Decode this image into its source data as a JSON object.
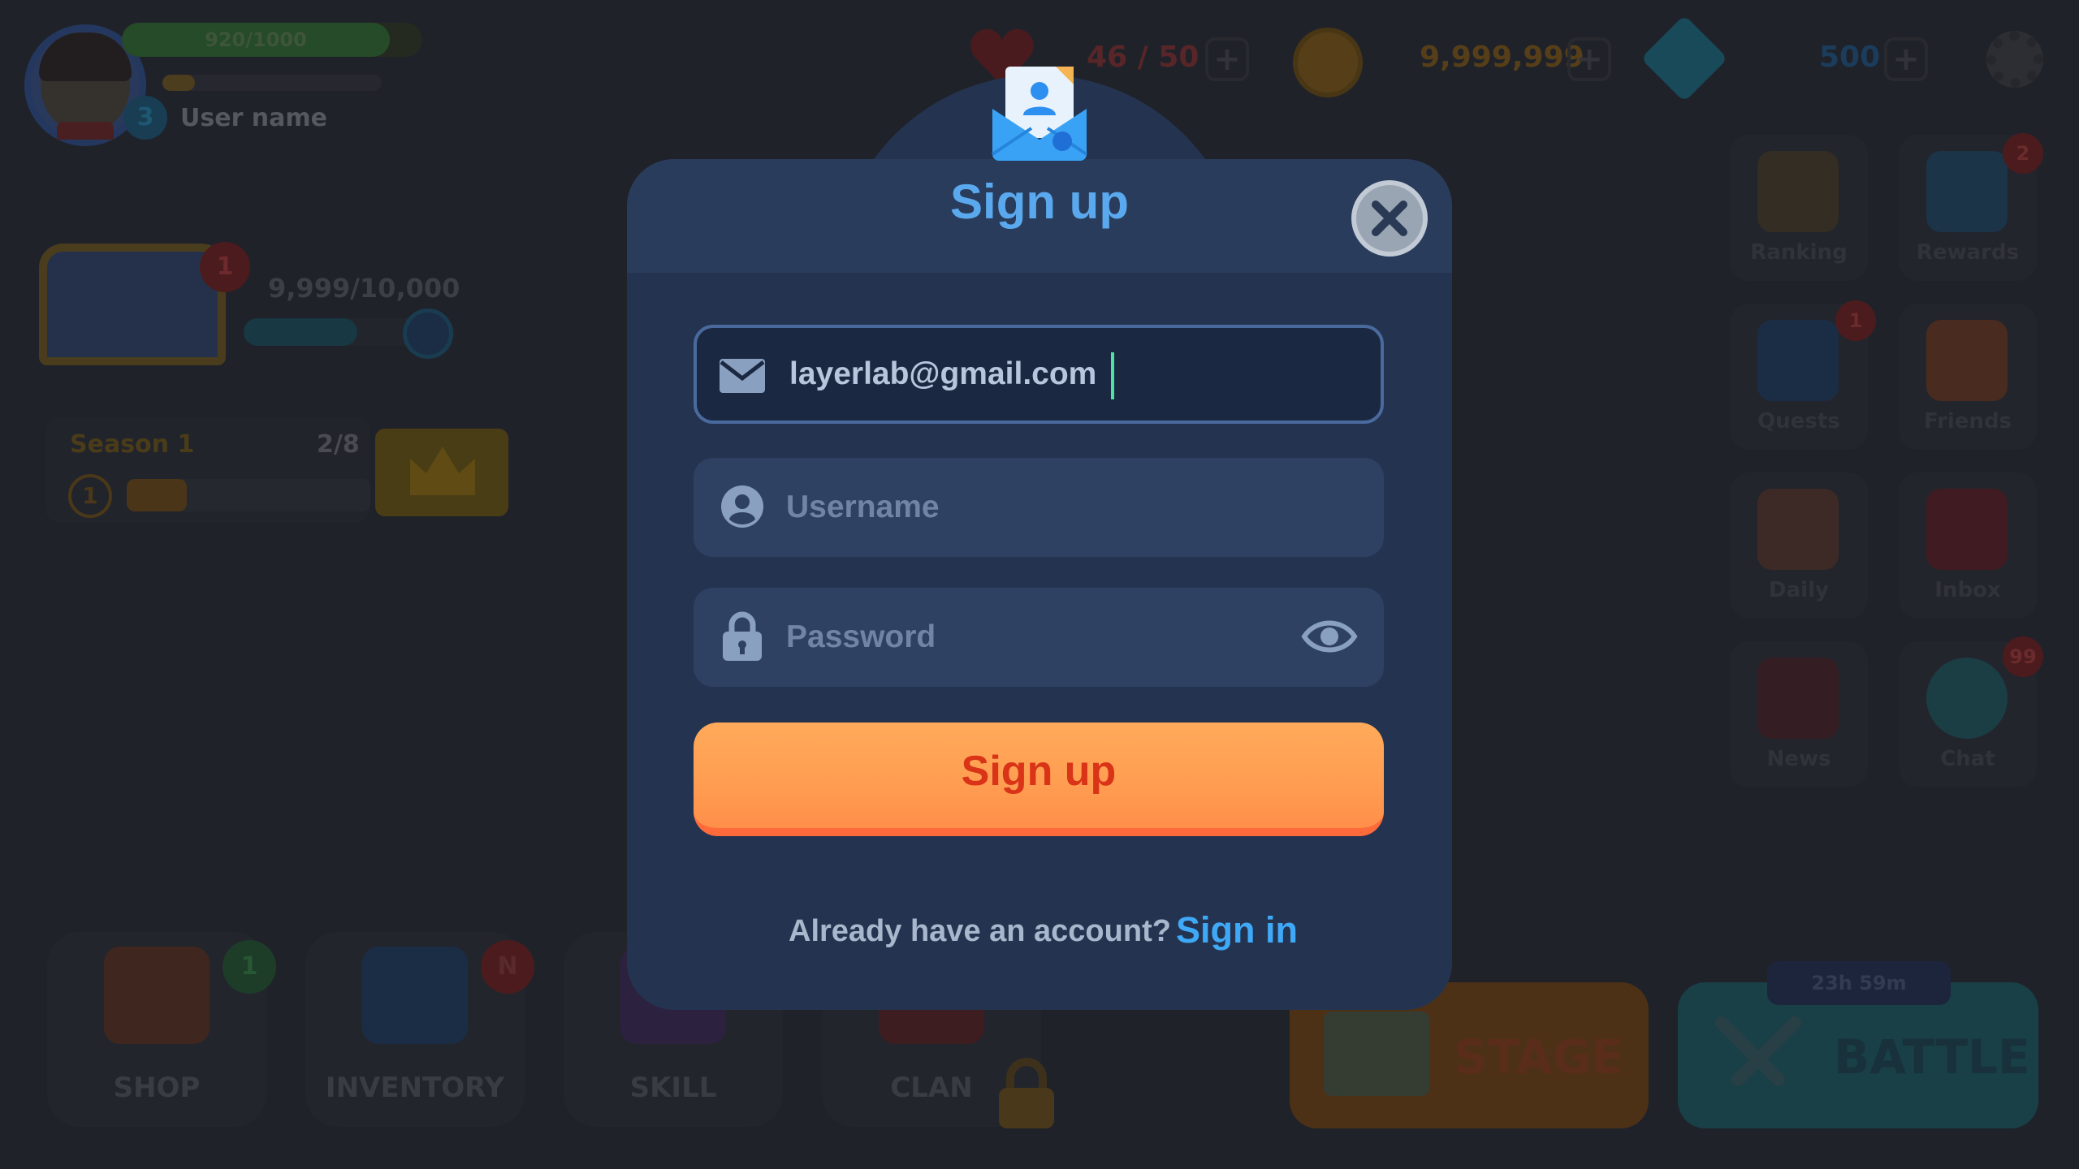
{
  "hud": {
    "xp_text": "920/1000",
    "level": "3",
    "user_name": "User name",
    "hearts": "46 / 50",
    "coins": "9,999,999",
    "gems": "500",
    "plus": "+"
  },
  "chest": {
    "badge": "1",
    "progress_text": "9,999/10,000"
  },
  "season": {
    "title": "Season 1",
    "count": "2/8",
    "level": "1"
  },
  "side_menu": [
    {
      "label": "Ranking",
      "badge": ""
    },
    {
      "label": "Rewards",
      "badge": "2"
    },
    {
      "label": "Quests",
      "badge": "1"
    },
    {
      "label": "Friends",
      "badge": ""
    },
    {
      "label": "Daily",
      "badge": ""
    },
    {
      "label": "Inbox",
      "badge": ""
    },
    {
      "label": "News",
      "badge": ""
    },
    {
      "label": "Chat",
      "badge": "99"
    }
  ],
  "bottom_nav": [
    {
      "label": "SHOP",
      "badge": "1"
    },
    {
      "label": "INVENTORY",
      "badge": "N"
    },
    {
      "label": "SKILL",
      "badge": ""
    },
    {
      "label": "CLAN",
      "badge": ""
    }
  ],
  "stage": {
    "label": "STAGE"
  },
  "battle": {
    "label": "BATTLE",
    "timer": "23h 59m"
  },
  "modal": {
    "title": "Sign up",
    "email": {
      "value": "layerlab@gmail.com",
      "icon": "mail-icon"
    },
    "username": {
      "placeholder": "Username",
      "icon": "user-icon"
    },
    "password": {
      "placeholder": "Password",
      "icon": "lock-icon",
      "toggle_icon": "eye-icon"
    },
    "submit_label": "Sign up",
    "footer_text": "Already have an account?",
    "footer_link": "Sign in"
  },
  "colors": {
    "modal_bg": "#243450",
    "title": "#5aa9ee",
    "button": "#ff9e52",
    "button_text": "#d93318",
    "link": "#3fa9f7"
  }
}
